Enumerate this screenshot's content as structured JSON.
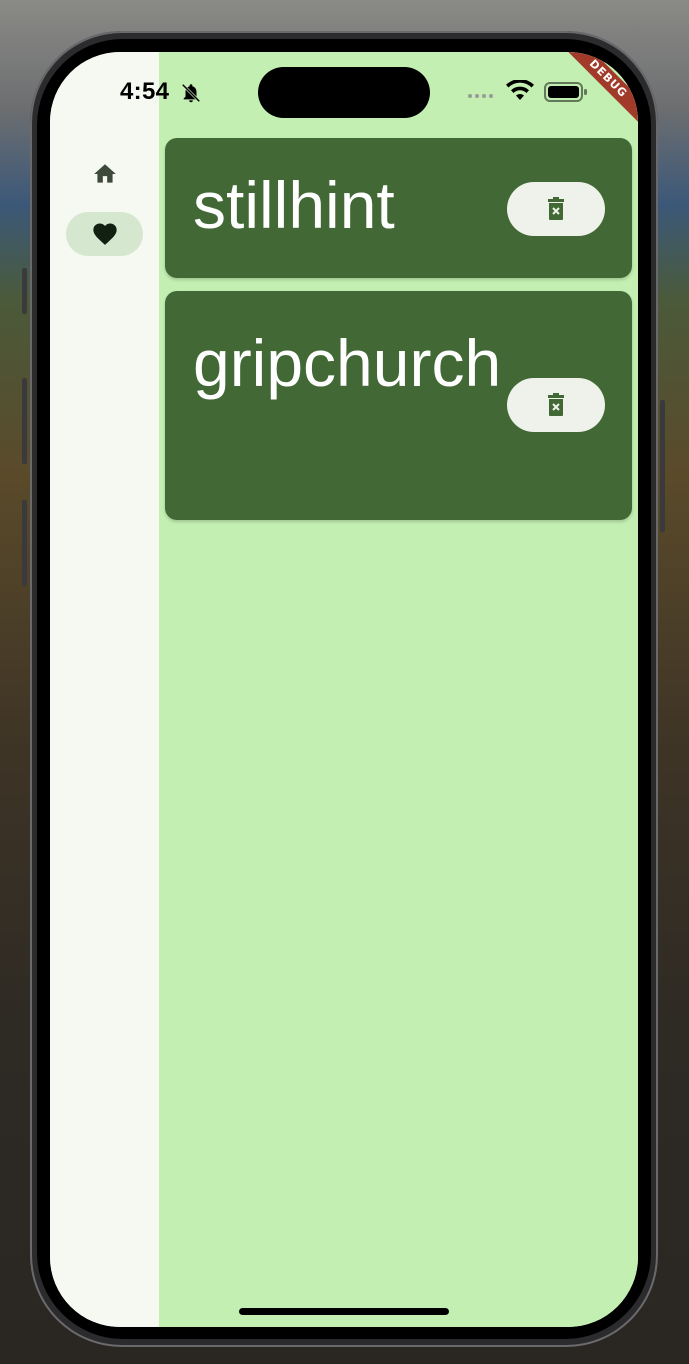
{
  "status_bar": {
    "time": "4:54",
    "icons": [
      "bell-slash-icon",
      "cellular-dots-icon",
      "wifi-icon",
      "battery-icon"
    ]
  },
  "debug_banner": {
    "label": "DEBUG",
    "color": "#a23a2a"
  },
  "navigation_rail": {
    "items": [
      {
        "icon": "home-icon",
        "selected": false
      },
      {
        "icon": "heart-icon",
        "selected": true
      }
    ]
  },
  "favorites": [
    {
      "word": "stillhint",
      "action_icon": "delete-icon"
    },
    {
      "word": "gripchurch",
      "action_icon": "delete-icon"
    }
  ],
  "colors": {
    "background": "#c3f0b2",
    "card": "#426935",
    "card_text": "#ffffff",
    "rail": "#f6f9f1",
    "rail_indicator": "#d5e8cf",
    "button": "#eff2ea"
  }
}
